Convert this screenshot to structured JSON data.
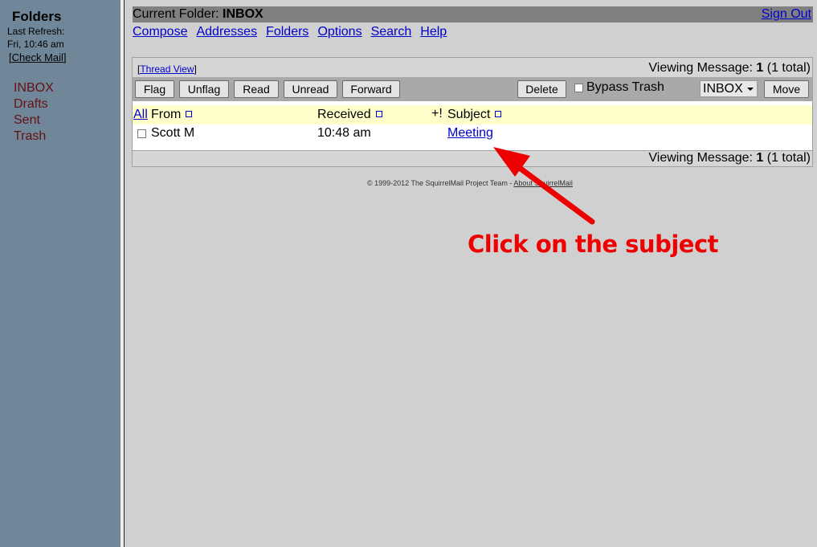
{
  "left_pane": {
    "title": "Folders",
    "last_refresh_label": "Last Refresh:",
    "last_refresh_time": "Fri, 10:46 am",
    "check_mail_open": "[",
    "check_mail_label": "Check Mail",
    "check_mail_close": "]",
    "folders": [
      "INBOX",
      "Drafts",
      "Sent",
      "Trash"
    ]
  },
  "header": {
    "current_folder_label": "Current Folder: ",
    "current_folder_value": "INBOX",
    "sign_out": "Sign Out"
  },
  "nav": [
    "Compose",
    "Addresses",
    "Folders",
    "Options",
    "Search",
    "Help"
  ],
  "message_box": {
    "thread_view_open": "[",
    "thread_view_label": "Thread View",
    "thread_view_close": "]",
    "viewing_prefix": "Viewing Message: ",
    "viewing_number": "1",
    "viewing_suffix": " (1 total)",
    "toolbar": {
      "flag": "Flag",
      "unflag": "Unflag",
      "read": "Read",
      "unread": "Unread",
      "forward": "Forward",
      "delete": "Delete",
      "bypass_trash": "Bypass Trash",
      "folder_select": "INBOX",
      "move": "Move"
    },
    "columns": {
      "all": "All",
      "from": "From",
      "received": "Received",
      "flags": "+!",
      "subject": "Subject"
    },
    "messages": [
      {
        "from": "Scott M",
        "received": "10:48 am",
        "subject": "Meeting"
      }
    ]
  },
  "footer": {
    "copyright": "© 1999-2012 The SquirrelMail Project Team - ",
    "about_link": "About SquirrelMail"
  },
  "annotation": {
    "text": "Click on the subject",
    "color": "#ee0000"
  }
}
